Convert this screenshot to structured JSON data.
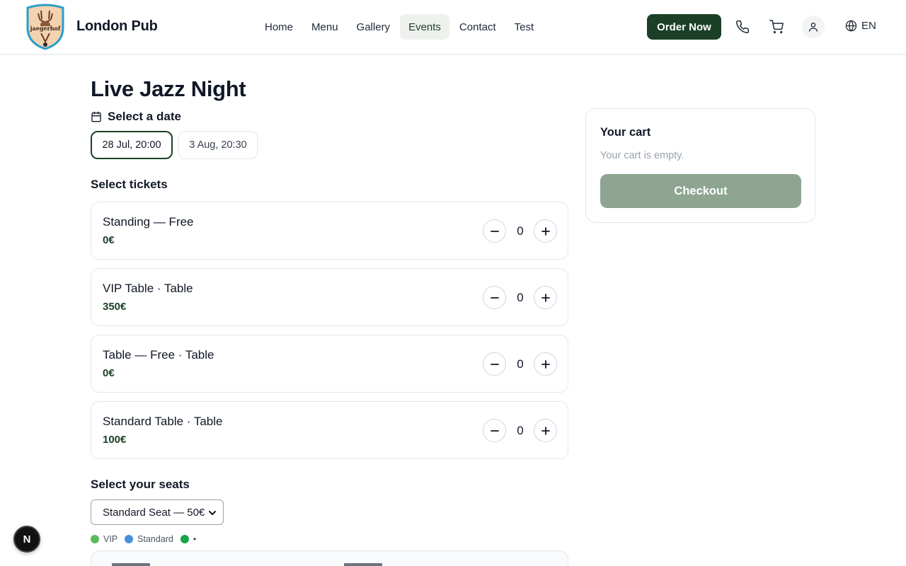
{
  "header": {
    "brand": "London Pub",
    "logo_text": "Jaegerhof",
    "nav": [
      {
        "label": "Home",
        "active": false
      },
      {
        "label": "Menu",
        "active": false
      },
      {
        "label": "Gallery",
        "active": false
      },
      {
        "label": "Events",
        "active": true
      },
      {
        "label": "Contact",
        "active": false
      },
      {
        "label": "Test",
        "active": false
      }
    ],
    "order_button": "Order Now",
    "language": "EN"
  },
  "event": {
    "title": "Live Jazz Night",
    "date_heading": "Select a date",
    "dates": [
      {
        "label": "28 Jul, 20:00",
        "selected": true
      },
      {
        "label": "3 Aug, 20:30",
        "selected": false
      }
    ]
  },
  "tickets": {
    "heading": "Select tickets",
    "items": [
      {
        "name": "Standing — Free",
        "price": "0€",
        "quantity": "0"
      },
      {
        "name": "VIP Table · Table",
        "price": "350€",
        "quantity": "0"
      },
      {
        "name": "Table — Free · Table",
        "price": "0€",
        "quantity": "0"
      },
      {
        "name": "Standard Table · Table",
        "price": "100€",
        "quantity": "0"
      }
    ]
  },
  "seats": {
    "heading": "Select your seats",
    "selected_option": "Standard Seat — 50€",
    "legend": [
      {
        "label": "VIP",
        "color": "#5cb85c"
      },
      {
        "label": "Standard",
        "color": "#4a8fdb"
      },
      {
        "label": "•",
        "color": "#16a34a"
      }
    ]
  },
  "cart": {
    "title": "Your cart",
    "empty_text": "Your cart is empty.",
    "checkout_label": "Checkout"
  },
  "dev_badge": "N",
  "colors": {
    "primary": "#1b4027",
    "primary_disabled": "#8ea592",
    "nav_active_bg": "#eef1ee",
    "border": "#e5e7eb"
  }
}
